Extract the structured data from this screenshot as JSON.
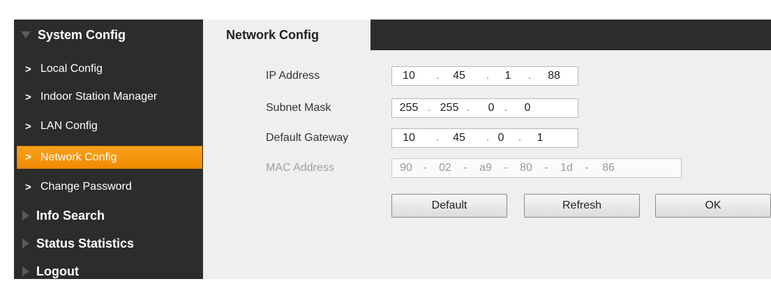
{
  "sidebar": {
    "sections": [
      {
        "label": "System Config",
        "expanded": true
      },
      {
        "label": "Info Search",
        "expanded": false
      },
      {
        "label": "Status Statistics",
        "expanded": false
      },
      {
        "label": "Logout",
        "expanded": false
      }
    ],
    "items": [
      {
        "label": "Local Config",
        "active": false
      },
      {
        "label": "Indoor Station Manager",
        "active": false
      },
      {
        "label": "LAN Config",
        "active": false
      },
      {
        "label": "Network Config",
        "active": true
      },
      {
        "label": "Change Password",
        "active": false
      }
    ],
    "chevron": ">"
  },
  "main": {
    "tab_title": "Network Config",
    "fields": {
      "ip_address": {
        "label": "IP Address",
        "octets": [
          "10",
          "45",
          "1",
          "88"
        ],
        "separator": "."
      },
      "subnet_mask": {
        "label": "Subnet Mask",
        "octets": [
          "255",
          "255",
          "0",
          "0"
        ],
        "separator": "."
      },
      "default_gateway": {
        "label": "Default Gateway",
        "octets": [
          "10",
          "45",
          "0",
          "1"
        ],
        "separator": "."
      },
      "mac_address": {
        "label": "MAC Address",
        "octets": [
          "90",
          "02",
          "a9",
          "80",
          "1d",
          "86"
        ],
        "separator": "-",
        "disabled": true
      }
    },
    "buttons": {
      "default_label": "Default",
      "refresh_label": "Refresh",
      "ok_label": "OK"
    }
  },
  "colors": {
    "background": "#2c2c2c",
    "panel": "#efefef",
    "accent": "#f39a10",
    "text_light": "#ffffff"
  },
  "icons": {
    "expanded": "triangle-down-icon",
    "collapsed": "triangle-right-icon",
    "item": "chevron-right-icon"
  }
}
